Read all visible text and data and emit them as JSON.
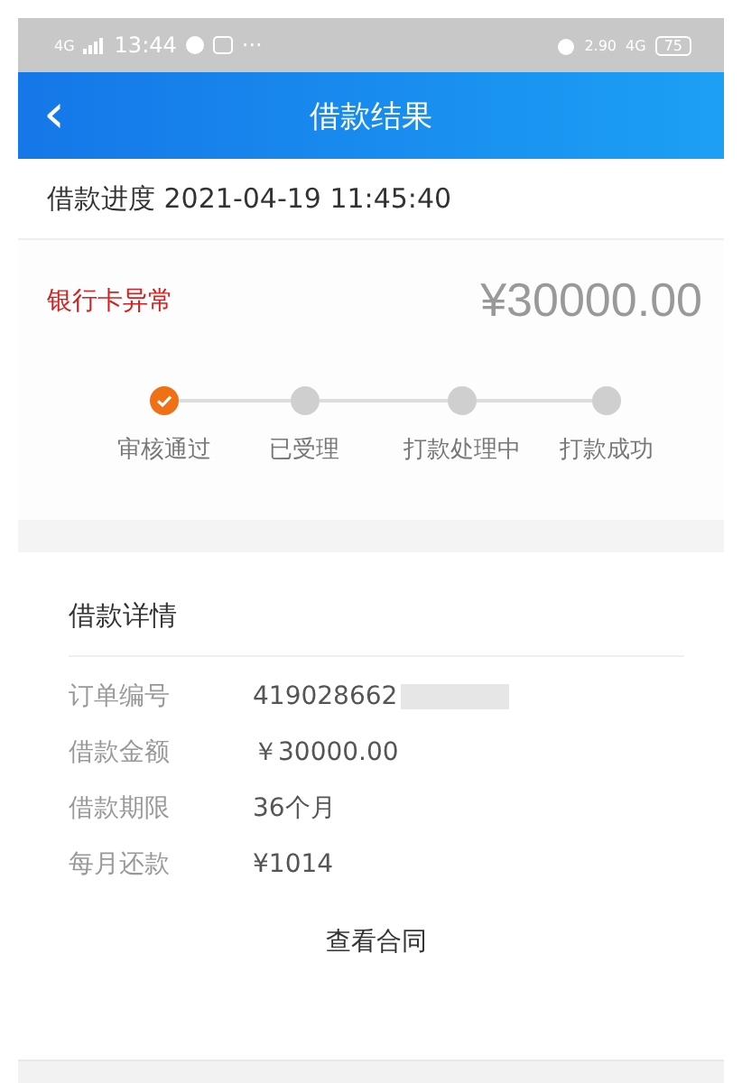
{
  "status_bar": {
    "network": "4G",
    "time": "13:44",
    "notifications": "···",
    "speed": "2.90",
    "signal": "4G",
    "battery": "75"
  },
  "header": {
    "back": "‹",
    "title": "借款结果"
  },
  "progress": {
    "label": "借款进度",
    "datetime": "2021-04-19 11:45:40"
  },
  "status": {
    "text": "银行卡异常",
    "amount": "¥30000.00"
  },
  "steps": [
    {
      "label": "审核通过",
      "done": true
    },
    {
      "label": "已受理",
      "done": false
    },
    {
      "label": "打款处理中",
      "done": false
    },
    {
      "label": "打款成功",
      "done": false
    }
  ],
  "details": {
    "title": "借款详情",
    "rows": [
      {
        "label": "订单编号",
        "value": "419028662",
        "redacted": true
      },
      {
        "label": "借款金额",
        "value": "￥30000.00",
        "redacted": false
      },
      {
        "label": "借款期限",
        "value": "36个月",
        "redacted": false
      },
      {
        "label": "每月还款",
        "value": "¥1014",
        "redacted": false
      }
    ],
    "link": "查看合同"
  }
}
